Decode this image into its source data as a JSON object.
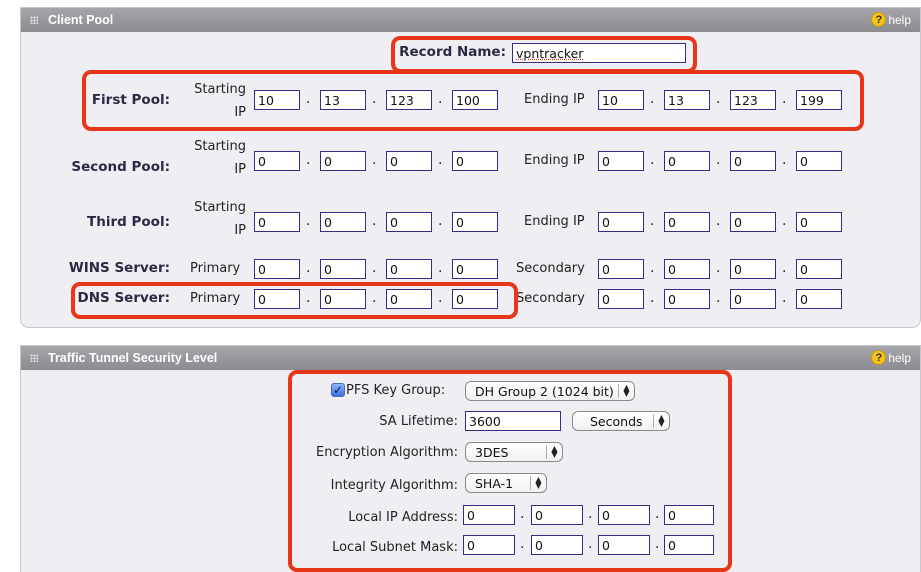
{
  "client_pool": {
    "title": "Client Pool",
    "help": "help",
    "record_name_label": "Record Name:",
    "record_name_value": "vpntracker",
    "starting_label_line1": "Starting",
    "starting_label_line2": "IP",
    "ending_label": "Ending IP",
    "first_pool": {
      "label": "First Pool:",
      "start": [
        "10",
        "13",
        "123",
        "100"
      ],
      "end": [
        "10",
        "13",
        "123",
        "199"
      ]
    },
    "second_pool": {
      "label": "Second Pool:",
      "start": [
        "0",
        "0",
        "0",
        "0"
      ],
      "end": [
        "0",
        "0",
        "0",
        "0"
      ]
    },
    "third_pool": {
      "label": "Third Pool:",
      "start": [
        "0",
        "0",
        "0",
        "0"
      ],
      "end": [
        "0",
        "0",
        "0",
        "0"
      ]
    },
    "wins": {
      "label": "WINS Server:",
      "primary_label": "Primary",
      "secondary_label": "Secondary",
      "primary": [
        "0",
        "0",
        "0",
        "0"
      ],
      "secondary": [
        "0",
        "0",
        "0",
        "0"
      ]
    },
    "dns": {
      "label": "DNS Server:",
      "primary_label": "Primary",
      "secondary_label": "Secondary",
      "primary": [
        "0",
        "0",
        "0",
        "0"
      ],
      "secondary": [
        "0",
        "0",
        "0",
        "0"
      ]
    }
  },
  "traffic": {
    "title": "Traffic Tunnel Security Level",
    "help": "help",
    "pfs_label": "PFS Key Group:",
    "pfs_checked": true,
    "pfs_value": "DH Group 2 (1024 bit)",
    "sa_label": "SA Lifetime:",
    "sa_value": "3600",
    "sa_unit": "Seconds",
    "enc_label": "Encryption Algorithm:",
    "enc_value": "3DES",
    "int_label": "Integrity Algorithm:",
    "int_value": "SHA-1",
    "local_ip_label": "Local IP Address:",
    "local_ip": [
      "0",
      "0",
      "0",
      "0"
    ],
    "local_mask_label": "Local Subnet Mask:",
    "local_mask": [
      "0",
      "0",
      "0",
      "0"
    ]
  },
  "colors": {
    "highlight": "#e8361b",
    "header": "#9a9aa0",
    "panel": "#efeff3",
    "input_border": "#3a2a88"
  },
  "icons": [
    "grip-icon",
    "help-icon",
    "checkmark-icon",
    "select-arrows-icon"
  ]
}
